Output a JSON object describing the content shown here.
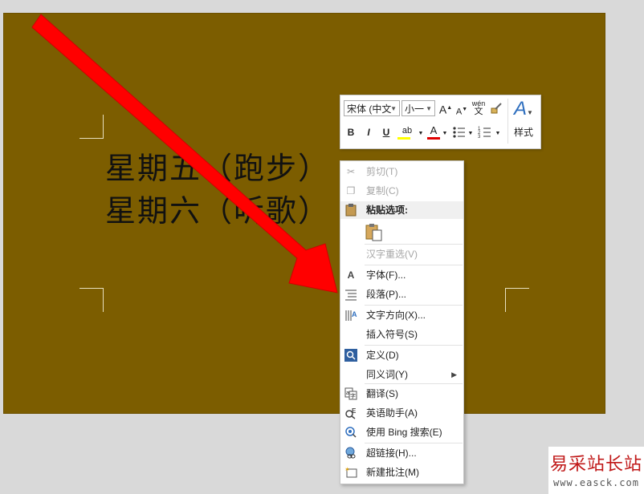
{
  "slide": {
    "lines": [
      "星期五（跑步）",
      "星期六（听歌）"
    ],
    "background": "#7c5d00"
  },
  "mini_toolbar": {
    "font_name": "宋体 (中文",
    "font_size": "小一",
    "grow_font": "A",
    "shrink_font": "A",
    "phonetic_top": "wén",
    "phonetic_bottom": "文",
    "bold": "B",
    "italic": "I",
    "underline": "U",
    "highlight": "ab",
    "font_color": "A",
    "styles_label": "样式",
    "styles_glyph": "A"
  },
  "context_menu": {
    "cut": "剪切(T)",
    "copy": "复制(C)",
    "paste_options": "粘贴选项:",
    "reconvert": "汉字重选(V)",
    "font": "字体(F)...",
    "paragraph": "段落(P)...",
    "text_direction": "文字方向(X)...",
    "insert_symbol": "插入符号(S)",
    "define": "定义(D)",
    "synonyms": "同义词(Y)",
    "translate": "翻译(S)",
    "english_assistant": "英语助手(A)",
    "bing_search": "使用 Bing 搜索(E)",
    "hyperlink": "超链接(H)...",
    "new_comment": "新建批注(M)"
  },
  "watermark": {
    "text": "易采站长站",
    "url": "www.easck.com"
  },
  "colors": {
    "arrow": "#ff0000",
    "slide_text": "#111111",
    "watermark_red": "#c01818"
  }
}
